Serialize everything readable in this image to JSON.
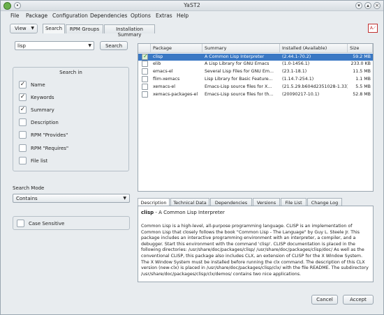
{
  "window": {
    "title": "YaST2"
  },
  "menu": [
    "File",
    "Package",
    "Configuration",
    "Dependencies",
    "Options",
    "Extras",
    "Help"
  ],
  "toolbar": {
    "view_label": "View",
    "tabs": [
      "Search",
      "RPM Groups",
      "Installation Summary"
    ]
  },
  "search": {
    "query": "lisp",
    "button_label": "Search",
    "group_title": "Search in",
    "options": [
      {
        "label": "Name",
        "checked": true
      },
      {
        "label": "Keywords",
        "checked": true
      },
      {
        "label": "Summary",
        "checked": true
      },
      {
        "label": "Description",
        "checked": false
      },
      {
        "label": "RPM \"Provides\"",
        "checked": false
      },
      {
        "label": "RPM \"Requires\"",
        "checked": false
      },
      {
        "label": "File list",
        "checked": false
      }
    ],
    "mode_label": "Search Mode",
    "mode_value": "Contains",
    "case_label": "Case Sensitive",
    "case_checked": false
  },
  "packages": {
    "columns": [
      "Package",
      "Summary",
      "Installed (Available)",
      "Size"
    ],
    "rows": [
      {
        "checked": true,
        "selected": true,
        "name": "clisp",
        "summary": "A Common Lisp Interpreter",
        "installed": "(2.44.1-70.2)",
        "size": "59.2 MB"
      },
      {
        "checked": false,
        "selected": false,
        "name": "elib",
        "summary": "A Lisp Library for GNU Emacs",
        "installed": "(1.0-1456.1)",
        "size": "233.0 KB"
      },
      {
        "checked": false,
        "selected": false,
        "name": "emacs-el",
        "summary": "Several Lisp Files for GNU Em...",
        "installed": "(23.1-18.1)",
        "size": "11.5 MB"
      },
      {
        "checked": false,
        "selected": false,
        "name": "flim-xemacs",
        "summary": "Lisp Library for Basic Feature...",
        "installed": "(1.14.7-254.1)",
        "size": "1.1 MB"
      },
      {
        "checked": false,
        "selected": false,
        "name": "xemacs-el",
        "summary": "Emacs-Lisp source files for X...",
        "installed": "(21.5.29.b604d2351028-1.33)",
        "size": "5.5 MB"
      },
      {
        "checked": false,
        "selected": false,
        "name": "xemacs-packages-el",
        "summary": "Emacs-Lisp source files for th...",
        "installed": "(20090217-10.1)",
        "size": "52.8 MB"
      }
    ]
  },
  "details": {
    "tabs": [
      "Description",
      "Technical Data",
      "Dependencies",
      "Versions",
      "File List",
      "Change Log"
    ],
    "active_tab": "Description",
    "pkg_name": "clisp",
    "pkg_summary": " - A Common Lisp Interpreter",
    "text": "Common Lisp is a high-level, all-purpose programming language. CLISP is an implementation of Common Lisp that closely follows the book \"Common Lisp - The Language\" by Guy L. Steele Jr. This package includes an interactive programming environment with an interpreter, a compiler, and a debugger. Start this environment with the command 'clisp'. CLISP documentation is placed in the following directories: /usr/share/doc/packages/clisp/ /usr/share/doc/packages/clisp/doc/ As well as the conventional CLISP, this package also includes CLX, an extension of CLISP for the X Window System. The X Window System must be installed before running the clx command. The description of this CLX version (new-clx) is placed in /usr/share/doc/packages/clisp/clx/ with the file README. The subdirectory /usr/share/doc/packages/clisp/clx/demos/ contains two nice applications."
  },
  "buttons": {
    "cancel": "Cancel",
    "accept": "Accept"
  }
}
